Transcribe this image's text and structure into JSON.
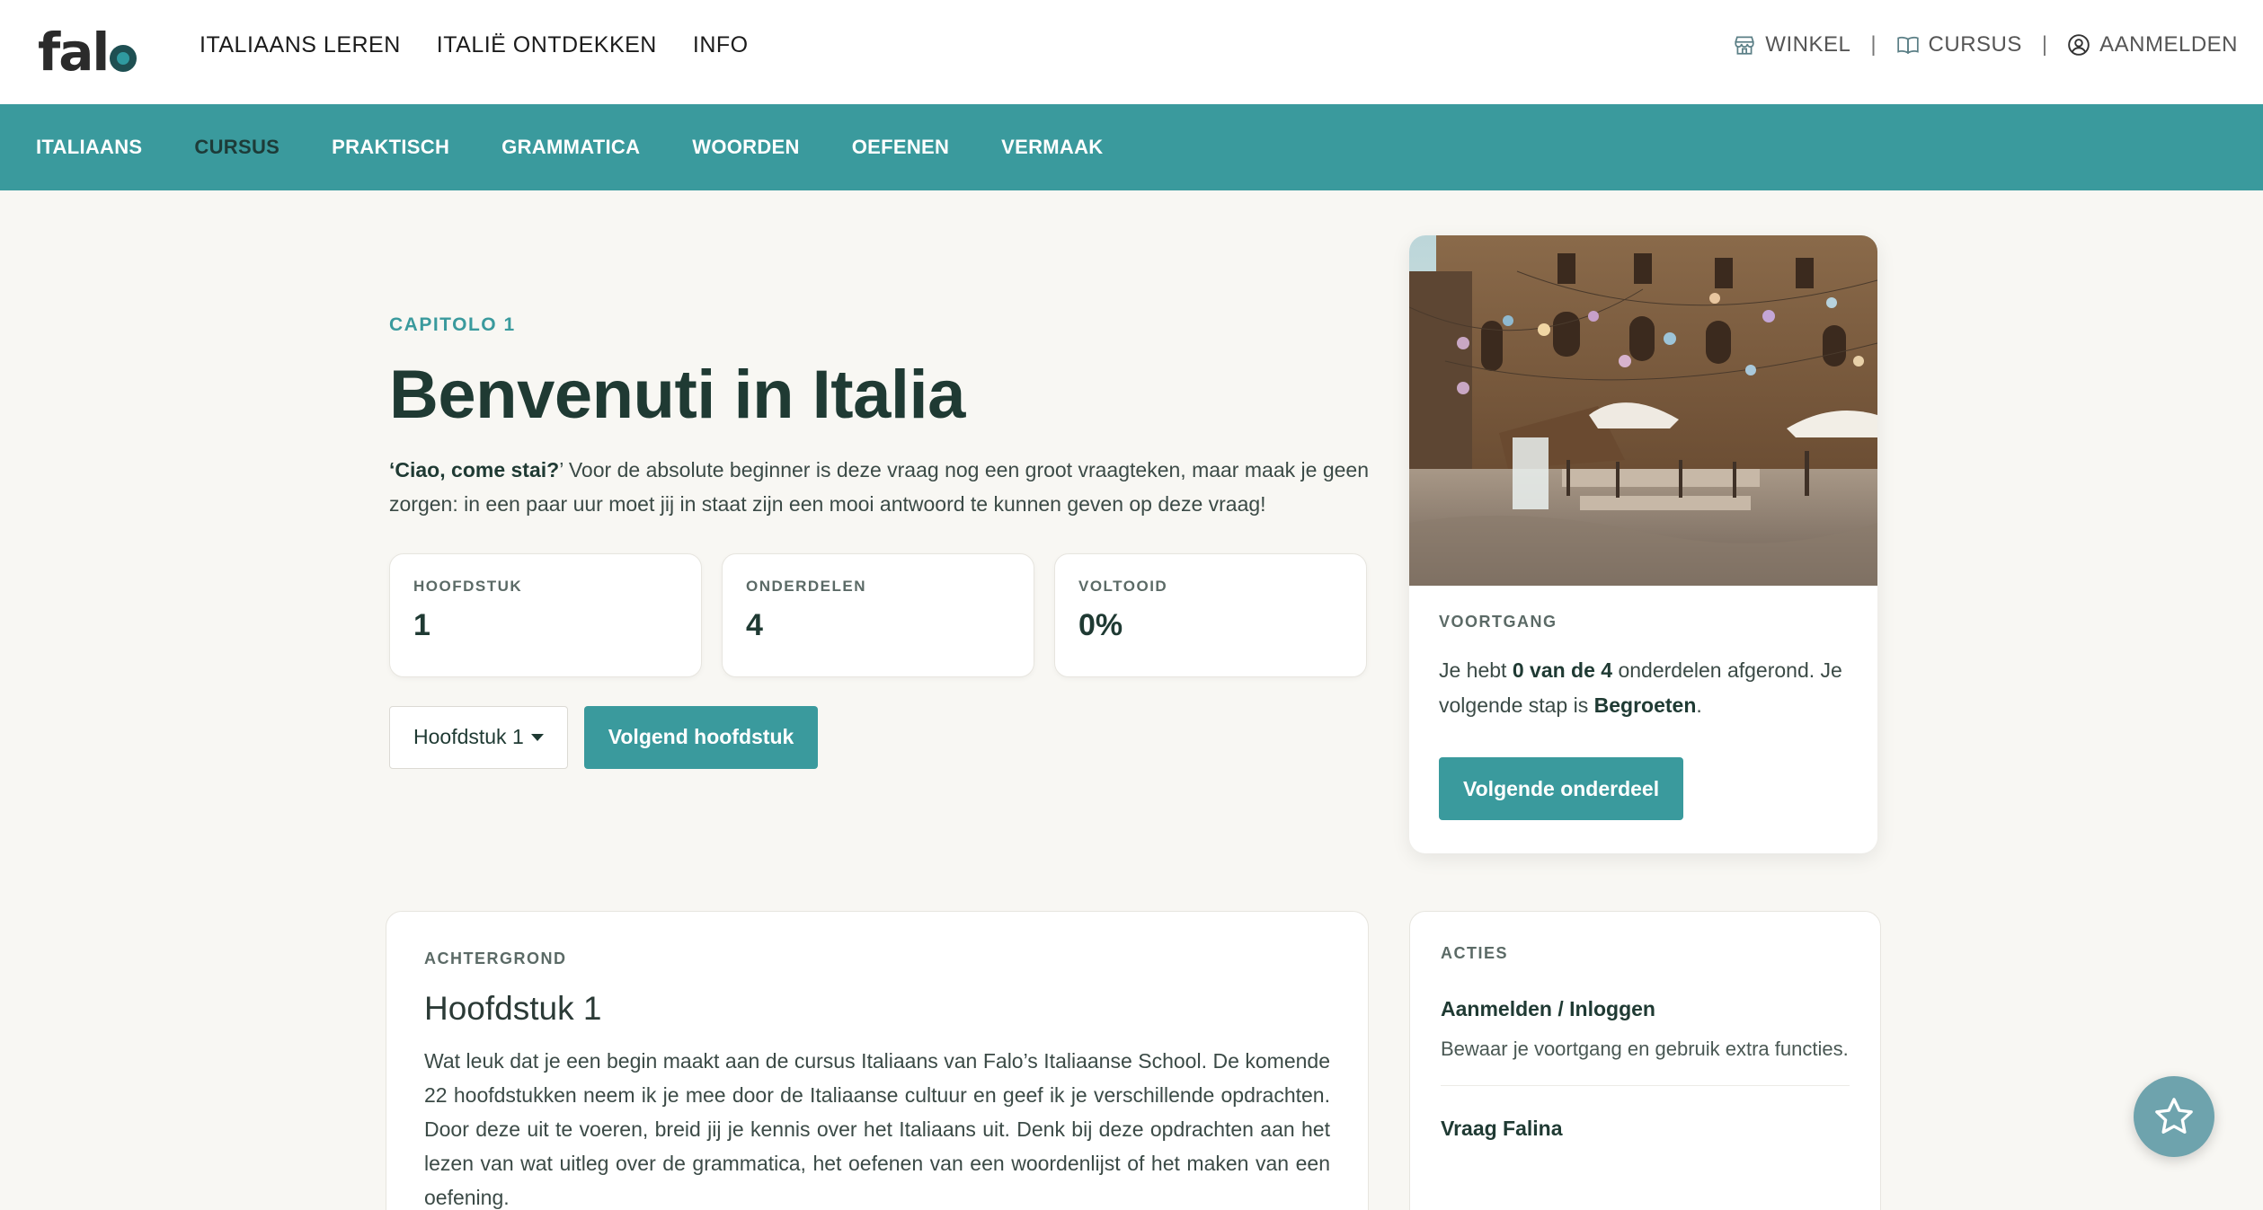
{
  "header": {
    "logo": "falo",
    "main_nav": [
      "ITALIAANS LEREN",
      "ITALIË ONTDEKKEN",
      "INFO"
    ],
    "util_nav": {
      "shop": "WINKEL",
      "course": "CURSUS",
      "login": "AANMELDEN",
      "separator": "|"
    }
  },
  "subnav": {
    "items": [
      "ITALIAANS",
      "CURSUS",
      "PRAKTISCH",
      "GRAMMATICA",
      "WOORDEN",
      "OEFENEN",
      "VERMAAK"
    ],
    "active": "CURSUS"
  },
  "hero": {
    "eyebrow": "CAPITOLO 1",
    "title": "Benvenuti in Italia",
    "lead_quote": "‘Ciao, come stai?",
    "lead_rest": "’ Voor de absolute beginner is deze vraag nog een groot vraagteken, maar maak je geen zorgen: in een paar uur moet jij in staat zijn een mooi antwoord te kunnen geven op deze vraag!",
    "stats": [
      {
        "label": "HOOFDSTUK",
        "value": "1"
      },
      {
        "label": "ONDERDELEN",
        "value": "4"
      },
      {
        "label": "VOLTOOID",
        "value": "0%"
      }
    ],
    "chapter_select": "Hoofdstuk 1",
    "next_chapter": "Volgend hoofdstuk"
  },
  "progress": {
    "label": "VOORTGANG",
    "text_1": "Je hebt ",
    "text_bold_1": "0 van de 4",
    "text_2": " onderdelen afgerond. Je volgende stap is ",
    "text_bold_2": "Begroeten",
    "text_3": ".",
    "button": "Volgende onderdeel"
  },
  "background": {
    "label": "ACHTERGROND",
    "title": "Hoofdstuk 1",
    "body": "Wat leuk dat je een begin maakt aan de cursus Italiaans van Falo’s Italiaanse School.  De komende 22 hoofdstukken neem ik je mee door de Italiaanse cultuur en geef ik je verschillende opdrachten. Door deze uit te voeren, breid jij je kennis over het Italiaans uit. Denk bij deze opdrachten aan het lezen van wat uitleg over de grammatica, het oefenen van een woordenlijst of het maken van een oefening."
  },
  "acties": {
    "label": "ACTIES",
    "items": [
      {
        "title": "Aanmelden / Inloggen",
        "desc": "Bewaar je voortgang en gebruik extra functies."
      },
      {
        "title": "Vraag Falina",
        "desc": ""
      }
    ]
  },
  "colors": {
    "accent": "#3a9a9d",
    "dark": "#1f3a33",
    "fab": "#6ea3ad"
  }
}
